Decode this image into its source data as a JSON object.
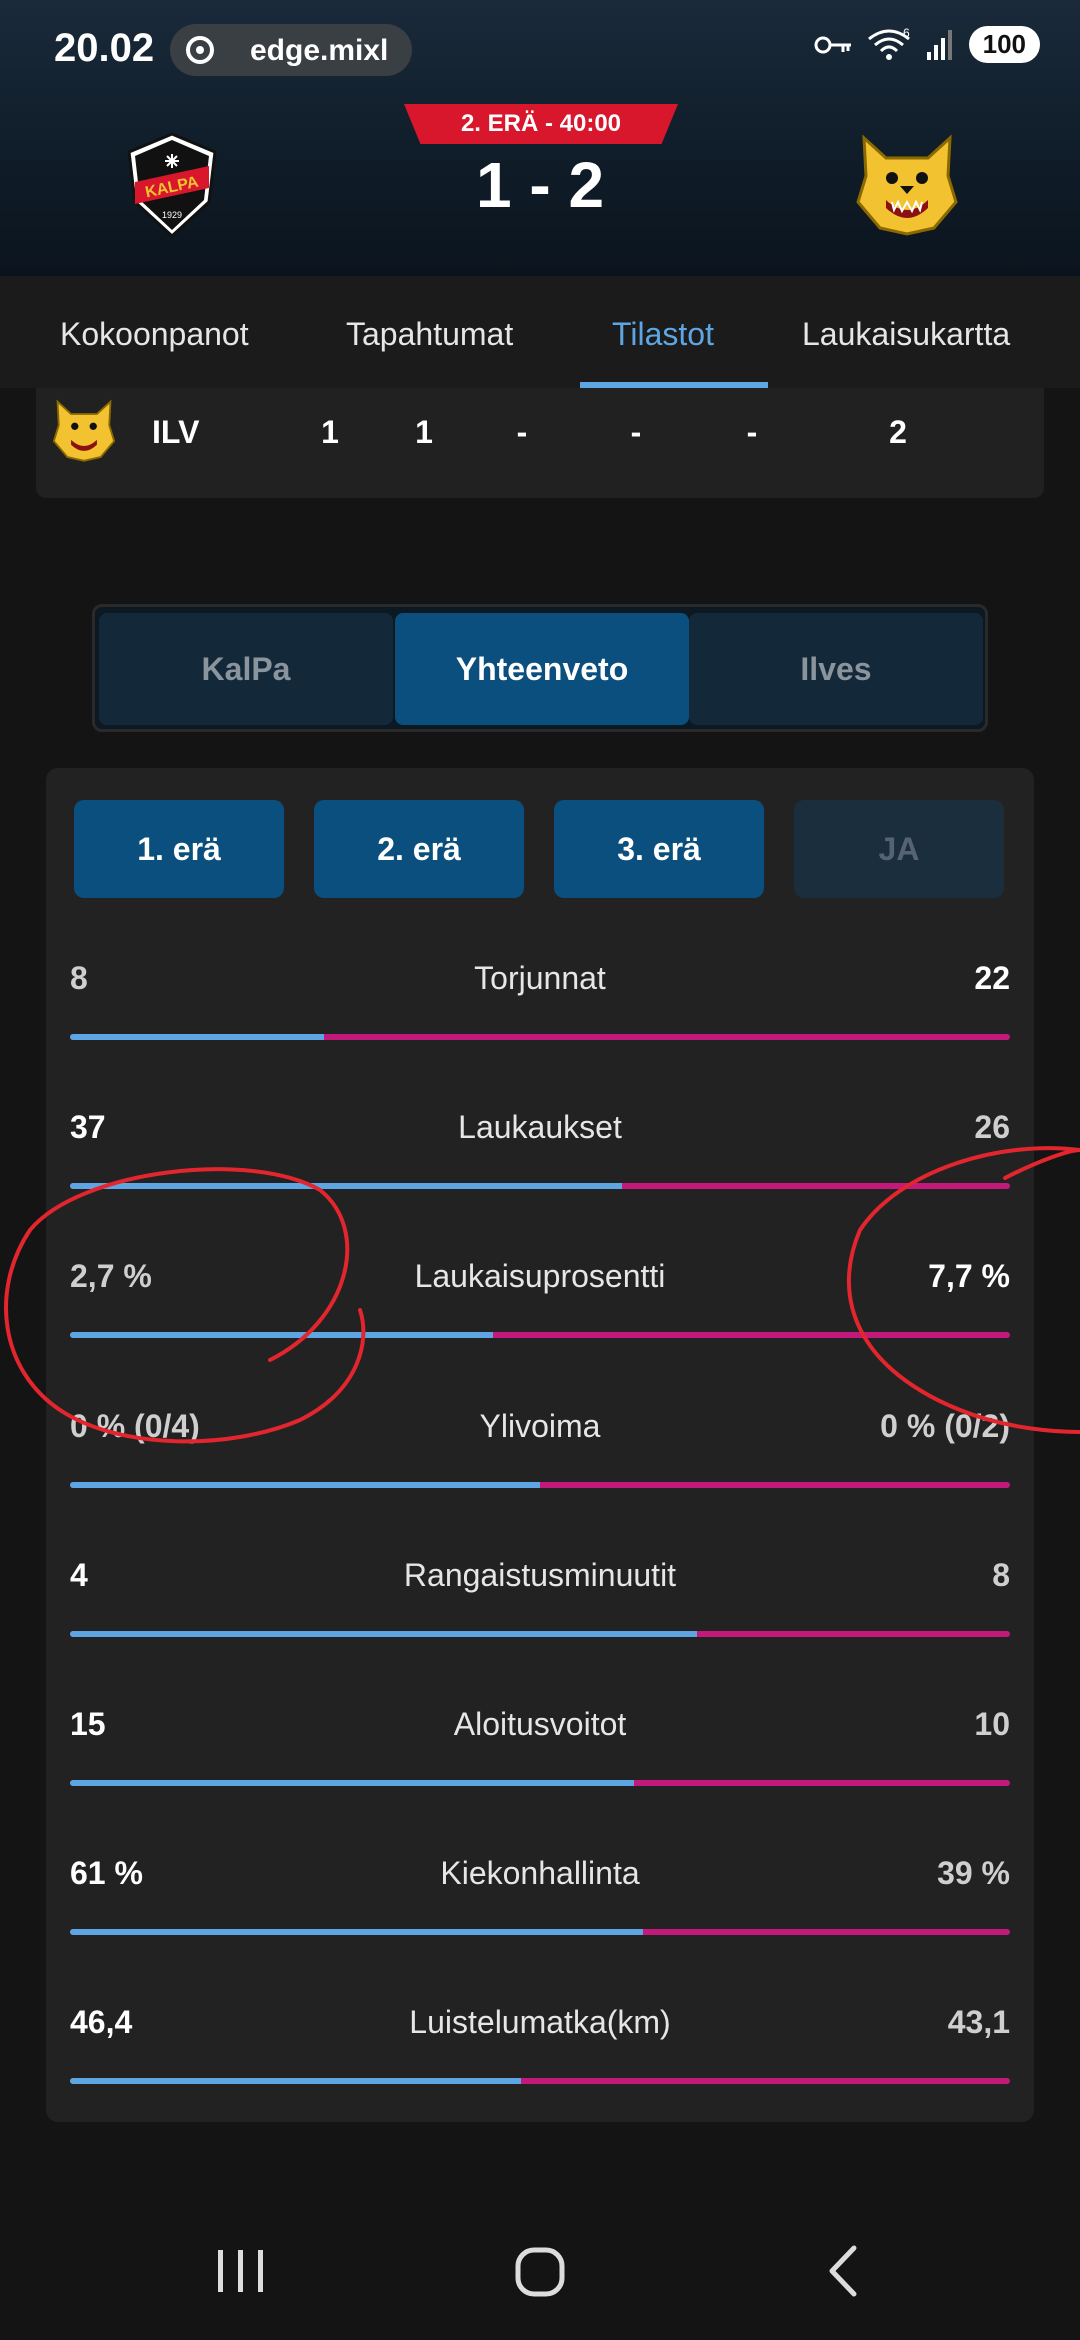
{
  "status_bar": {
    "time": "20.02",
    "url": "edge.mixl",
    "signal_number": "6",
    "battery": "100"
  },
  "header": {
    "period_badge": "2. ERÄ - 40:00",
    "score": "1 - 2",
    "home_logo_text": "KALPA",
    "home_logo_year": "1929",
    "home_team_icon": "kalpa-logo",
    "away_team_icon": "ilves-lynx-logo"
  },
  "tabs": [
    {
      "label": "Kokoonpanot",
      "active": false
    },
    {
      "label": "Tapahtumat",
      "active": false
    },
    {
      "label": "Tilastot",
      "active": true
    },
    {
      "label": "Laukaisukartta",
      "active": false
    }
  ],
  "period_score_row": {
    "team": "ILV",
    "cells": [
      "1",
      "1",
      "-",
      "-",
      "-",
      "2"
    ]
  },
  "team_segment": [
    {
      "label": "KalPa",
      "active": false
    },
    {
      "label": "Yhteenveto",
      "active": true
    },
    {
      "label": "Ilves",
      "active": false
    }
  ],
  "period_buttons": [
    {
      "label": "1. erä",
      "enabled": true
    },
    {
      "label": "2. erä",
      "enabled": true
    },
    {
      "label": "3. erä",
      "enabled": true
    },
    {
      "label": "JA",
      "enabled": false
    }
  ],
  "stats": [
    {
      "name": "Torjunnat",
      "home": "8",
      "away": "22",
      "home_share": 0.27
    },
    {
      "name": "Laukaukset",
      "home": "37",
      "away": "26",
      "home_share": 0.587
    },
    {
      "name": "Laukaisuprosentti",
      "home": "2,7 %",
      "away": "7,7 %",
      "home_share": 0.45
    },
    {
      "name": "Ylivoima",
      "home": "0 % (0/4)",
      "away": "0 % (0/2)",
      "home_share": 0.5
    },
    {
      "name": "Rangaistusminuutit",
      "home": "4",
      "away": "8",
      "home_share": 0.667
    },
    {
      "name": "Aloitusvoitot",
      "home": "15",
      "away": "10",
      "home_share": 0.6
    },
    {
      "name": "Kiekonhallinta",
      "home": "61 %",
      "away": "39 %",
      "home_share": 0.61
    },
    {
      "name": "Luistelumatka(km)",
      "home": "46,4",
      "away": "43,1",
      "home_share": 0.48
    }
  ],
  "colors": {
    "home_bar": "#5da6e3",
    "away_bar": "#c2197a",
    "accent_red": "#d8172c",
    "active_tab": "#5da6e3"
  },
  "nav_icons": [
    "recents-icon",
    "home-icon",
    "back-icon"
  ]
}
